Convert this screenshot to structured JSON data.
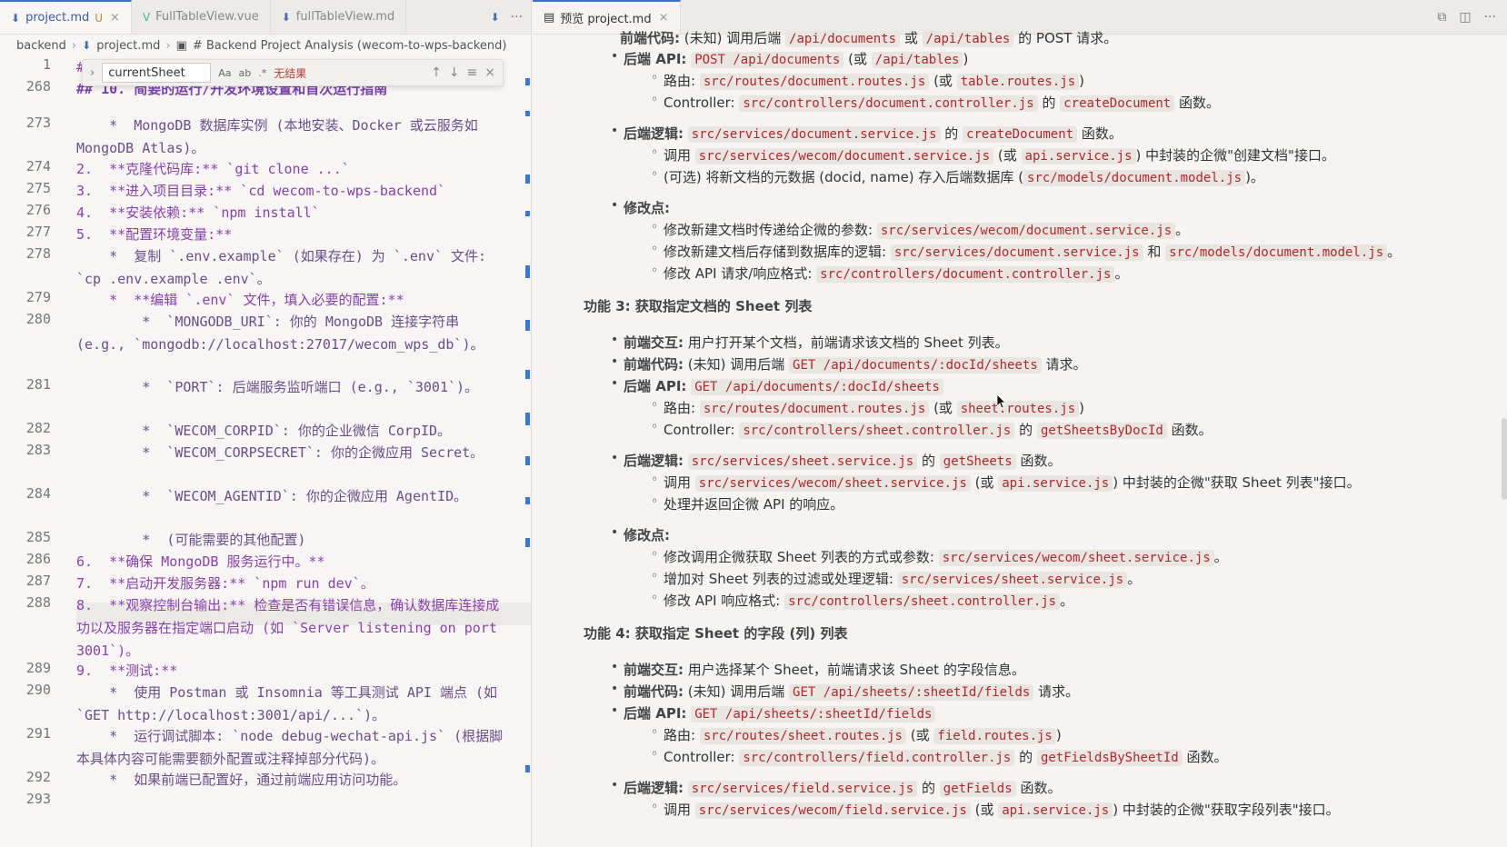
{
  "left": {
    "tabs": [
      {
        "label": "project.md",
        "modified": "U",
        "close": "×",
        "active": true
      },
      {
        "label": "FullTableView.vue"
      },
      {
        "label": "fullTableView.md"
      }
    ],
    "tab_more": "···",
    "breadcrumb": [
      "backend",
      "project.md",
      "# Backend Project Analysis (wecom-to-wps-backend)"
    ],
    "find": {
      "query": "currentSheet",
      "opt_case": "Aa",
      "opt_word": "ab",
      "opt_regex": ".*",
      "result": "无结果",
      "prev": "↑",
      "next": "↓",
      "menu": "≡",
      "close": "×"
    },
    "lines": [
      {
        "n": "1",
        "t": "#"
      },
      {
        "n": "268",
        "t": "## 10. 简要的运行/开发环境设置和首次运行指南"
      },
      {
        "n": "273",
        "t": "    *  MongoDB 数据库实例 (本地安装、Docker 或云服务如 MongoDB Atlas)。"
      },
      {
        "n": "274",
        "t": "2.  **克隆代码库:** `git clone ...`"
      },
      {
        "n": "275",
        "t": "3.  **进入项目目录:** `cd wecom-to-wps-backend`"
      },
      {
        "n": "276",
        "t": "4.  **安装依赖:** `npm install`"
      },
      {
        "n": "277",
        "t": "5.  **配置环境变量:**"
      },
      {
        "n": "278",
        "t": "    *  复制 `.env.example` (如果存在) 为 `.env` 文件: `cp .env.example .env`。"
      },
      {
        "n": "279",
        "t": "    *  **编辑 `.env` 文件，填入必要的配置:**"
      },
      {
        "n": "280",
        "t": "        *  `MONGODB_URI`: 你的 MongoDB 连接字符串 (e.g., `mongodb://localhost:27017/wecom_wps_db`)。"
      },
      {
        "n": "281",
        "t": "        *  `PORT`: 后端服务监听端口 (e.g., `3001`)。"
      },
      {
        "n": "282",
        "t": "        *  `WECOM_CORPID`: 你的企业微信 CorpID。"
      },
      {
        "n": "283",
        "t": "        *  `WECOM_CORPSECRET`: 你的企微应用 Secret。"
      },
      {
        "n": "284",
        "t": "        *  `WECOM_AGENTID`: 你的企微应用 AgentID。"
      },
      {
        "n": "285",
        "t": "        *  (可能需要的其他配置)"
      },
      {
        "n": "286",
        "t": "6.  **确保 MongoDB 服务运行中。**"
      },
      {
        "n": "287",
        "t": "7.  **启动开发服务器:** `npm run dev`。"
      },
      {
        "n": "288",
        "t": "8.  **观察控制台输出:** 检查是否有错误信息，确认数据库连接成功以及服务器在指定端口启动 (如 `Server listening on port 3001`)。"
      },
      {
        "n": "289",
        "t": "9.  **测试:**"
      },
      {
        "n": "290",
        "t": "    *  使用 Postman 或 Insomnia 等工具测试 API 端点 (如 `GET http://localhost:3001/api/...`)。"
      },
      {
        "n": "291",
        "t": "    *  运行调试脚本: `node debug-wechat-api.js` (根据脚本具体内容可能需要额外配置或注释掉部分代码)。"
      },
      {
        "n": "292",
        "t": "    *  如果前端已配置好，通过前端应用访问功能。"
      },
      {
        "n": "293",
        "t": ""
      }
    ]
  },
  "right": {
    "tab": {
      "label": "预览 project.md",
      "close": "×"
    },
    "top_line": {
      "label": "前端代码:",
      "text1": "(未知) 调用后端",
      "c1": "/api/documents",
      "text2": "或",
      "c2": "/api/tables",
      "text3": "的 POST 请求。"
    },
    "f2": {
      "api_label": "后端 API:",
      "api_code": "POST /api/documents",
      "api_or": "(或",
      "api_alt": "/api/tables",
      "api_close": ")",
      "route_label": "路由:",
      "route_code": "src/routes/document.routes.js",
      "route_or": "(或",
      "route_alt": "table.routes.js",
      "route_close": ")",
      "ctrl_label": "Controller:",
      "ctrl_code": "src/controllers/document.controller.js",
      "ctrl_of": "的",
      "ctrl_fn": "createDocument",
      "ctrl_tail": "函数。",
      "logic_label": "后端逻辑:",
      "logic_code": "src/services/document.service.js",
      "logic_of": "的",
      "logic_fn": "createDocument",
      "logic_tail": "函数。",
      "call_label": "调用",
      "call_code": "src/services/wecom/document.service.js",
      "call_or": "(或",
      "call_alt": "api.service.js",
      "call_tail": ") 中封装的企微\"创建文档\"接口。",
      "opt_text": "(可选) 将新文档的元数据 (docid, name) 存入后端数据库 (",
      "opt_code": "src/models/document.model.js",
      "opt_tail": ")。",
      "mod_label": "修改点:",
      "mod1_text": "修改新建文档时传递给企微的参数:",
      "mod1_code": "src/services/wecom/document.service.js",
      "mod1_tail": "。",
      "mod2_text": "修改新建文档后存储到数据库的逻辑:",
      "mod2_code": "src/services/document.service.js",
      "mod2_and": "和",
      "mod2_code2": "src/models/document.model.js",
      "mod2_tail": "。",
      "mod3_text": "修改 API 请求/响应格式:",
      "mod3_code": "src/controllers/document.controller.js",
      "mod3_tail": "。"
    },
    "f3": {
      "title": "功能 3: 获取指定文档的 Sheet 列表",
      "fe_label": "前端交互:",
      "fe_text": "用户打开某个文档，前端请求该文档的 Sheet 列表。",
      "code_label": "前端代码:",
      "code_text": "(未知) 调用后端",
      "code_code": "GET /api/documents/:docId/sheets",
      "code_tail": "请求。",
      "api_label": "后端 API:",
      "api_code": "GET /api/documents/:docId/sheets",
      "route_label": "路由:",
      "route_code": "src/routes/document.routes.js",
      "route_or": "(或",
      "route_alt": "sheet.routes.js",
      "route_close": ")",
      "ctrl_label": "Controller:",
      "ctrl_code": "src/controllers/sheet.controller.js",
      "ctrl_of": "的",
      "ctrl_fn": "getSheetsByDocId",
      "ctrl_tail": "函数。",
      "logic_label": "后端逻辑:",
      "logic_code": "src/services/sheet.service.js",
      "logic_of": "的",
      "logic_fn": "getSheets",
      "logic_tail": "函数。",
      "call_label": "调用",
      "call_code": "src/services/wecom/sheet.service.js",
      "call_or": "(或",
      "call_alt": "api.service.js",
      "call_tail": ") 中封装的企微\"获取 Sheet 列表\"接口。",
      "handle_text": "处理并返回企微 API 的响应。",
      "mod_label": "修改点:",
      "mod1_text": "修改调用企微获取 Sheet 列表的方式或参数:",
      "mod1_code": "src/services/wecom/sheet.service.js",
      "mod1_tail": "。",
      "mod2_text": "增加对 Sheet 列表的过滤或处理逻辑:",
      "mod2_code": "src/services/sheet.service.js",
      "mod2_tail": "。",
      "mod3_text": "修改 API 响应格式:",
      "mod3_code": "src/controllers/sheet.controller.js",
      "mod3_tail": "。"
    },
    "f4": {
      "title": "功能 4: 获取指定 Sheet 的字段 (列) 列表",
      "fe_label": "前端交互:",
      "fe_text": "用户选择某个 Sheet，前端请求该 Sheet 的字段信息。",
      "code_label": "前端代码:",
      "code_text": "(未知) 调用后端",
      "code_code": "GET /api/sheets/:sheetId/fields",
      "code_tail": "请求。",
      "api_label": "后端 API:",
      "api_code": "GET /api/sheets/:sheetId/fields",
      "route_label": "路由:",
      "route_code": "src/routes/sheet.routes.js",
      "route_or": "(或",
      "route_alt": "field.routes.js",
      "route_close": ")",
      "ctrl_label": "Controller:",
      "ctrl_code": "src/controllers/field.controller.js",
      "ctrl_of": "的",
      "ctrl_fn": "getFieldsBySheetId",
      "ctrl_tail": "函数。",
      "logic_label": "后端逻辑:",
      "logic_code": "src/services/field.service.js",
      "logic_of": "的",
      "logic_fn": "getFields",
      "logic_tail": "函数。",
      "call_label": "调用",
      "call_code": "src/services/wecom/field.service.js",
      "call_or": "(或",
      "call_alt": "api.service.js",
      "call_tail": ") 中封装的企微\"获取字段列表\"接口。"
    },
    "bullets": {
      "filled": "•",
      "hollow": "◦"
    }
  },
  "colors": {
    "accent": "#3b6fd0",
    "code_text": "#b3262b",
    "code_bg": "#e9e6e1"
  }
}
